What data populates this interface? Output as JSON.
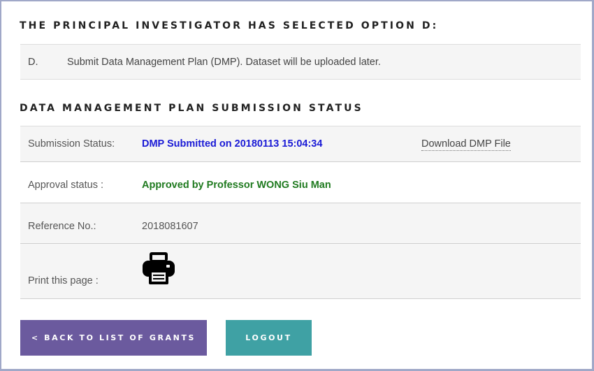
{
  "section_option": {
    "heading": "THE PRINCIPAL INVESTIGATOR HAS SELECTED OPTION D:",
    "option_letter": "D.",
    "option_text": "Submit Data Management Plan (DMP). Dataset will be uploaded later."
  },
  "section_status": {
    "heading": "DATA MANAGEMENT PLAN SUBMISSION STATUS",
    "rows": [
      {
        "label": "Submission Status:",
        "value": "DMP Submitted on 20180113 15:04:34",
        "link": "Download DMP File"
      },
      {
        "label": "Approval status :",
        "value": "Approved by Professor WONG Siu Man"
      },
      {
        "label": "Reference No.:",
        "value": "2018081607"
      },
      {
        "label": "Print this page :",
        "icon": "printer-icon"
      }
    ]
  },
  "buttons": {
    "back_label": "< BACK TO LIST OF GRANTS",
    "logout_label": "LOGOUT"
  },
  "colors": {
    "submitted_blue": "#1a1ad6",
    "approved_green": "#1f7a1f",
    "back_button_purple": "#6b5a9e",
    "logout_button_teal": "#3fa1a4"
  }
}
